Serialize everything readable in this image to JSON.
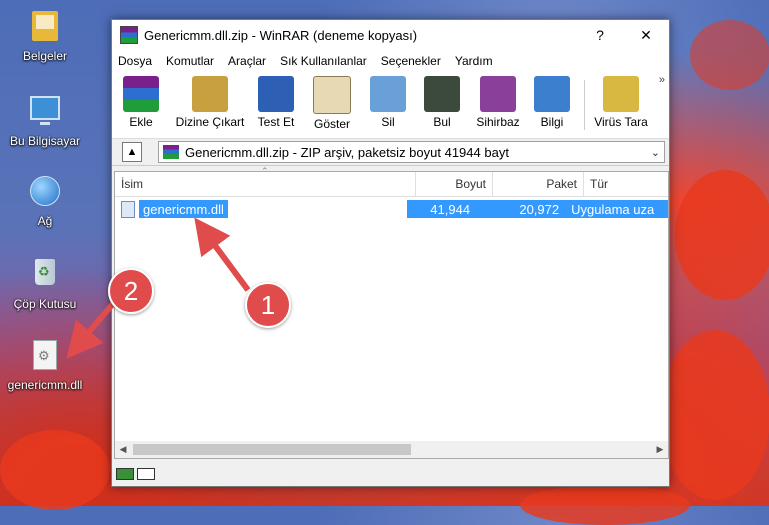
{
  "desktop": {
    "icons": [
      {
        "label": "Belgeler",
        "icon": "folder-icon"
      },
      {
        "label": "Bu Bilgisayar",
        "icon": "computer-icon"
      },
      {
        "label": "Ağ",
        "icon": "network-icon"
      },
      {
        "label": "Çöp Kutusu",
        "icon": "recycle-bin-icon"
      },
      {
        "label": "genericmm.dll",
        "icon": "dll-file-icon"
      }
    ]
  },
  "window": {
    "title": "Genericmm.dll.zip - WinRAR (deneme kopyası)",
    "help_glyph": "?",
    "close_glyph": "✕",
    "menu": [
      "Dosya",
      "Komutlar",
      "Araçlar",
      "Sık Kullanılanlar",
      "Seçenekler",
      "Yardım"
    ],
    "toolbar": [
      {
        "label": "Ekle",
        "icon": "add-archive-icon",
        "color": "#7b1f8a"
      },
      {
        "label": "Dizine Çıkart",
        "icon": "extract-icon",
        "color": "#c9a040"
      },
      {
        "label": "Test Et",
        "icon": "test-icon",
        "color": "#2d5fb5"
      },
      {
        "label": "Göster",
        "icon": "view-icon",
        "color": "#c8b27a"
      },
      {
        "label": "Sil",
        "icon": "delete-icon",
        "color": "#6aa0d8"
      },
      {
        "label": "Bul",
        "icon": "find-icon",
        "color": "#3b4a3a"
      },
      {
        "label": "Sihirbaz",
        "icon": "wizard-icon",
        "color": "#8a3f9a"
      },
      {
        "label": "Bilgi",
        "icon": "info-icon",
        "color": "#3c7fcf"
      },
      {
        "label": "Virüs Tara",
        "icon": "virus-scan-icon",
        "color": "#d8b840"
      }
    ],
    "toolbar_more": "»",
    "path": "Genericmm.dll.zip - ZIP arşiv, paketsiz boyut 41944 bayt",
    "columns": {
      "name": "İsim",
      "size": "Boyut",
      "packed": "Paket",
      "type": "Tür"
    },
    "files": [
      {
        "name": "genericmm.dll",
        "size": "41,944",
        "packed": "20,972",
        "type": "Uygulama uza"
      }
    ]
  },
  "callouts": {
    "one": "1",
    "two": "2"
  },
  "colors": {
    "selection": "#3399ff",
    "callout": "#e04b4b"
  }
}
